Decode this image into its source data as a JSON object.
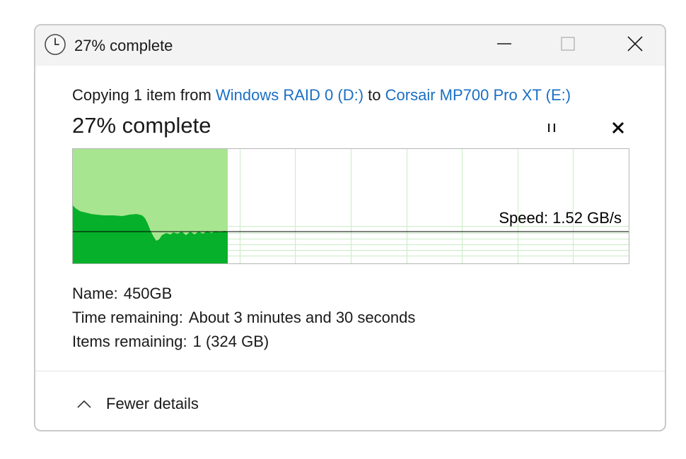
{
  "window": {
    "title": "27% complete"
  },
  "copy": {
    "prefix": "Copying 1 item from",
    "source": "Windows RAID 0 (D:)",
    "connector": "to",
    "destination": "Corsair MP700 Pro XT (E:)"
  },
  "progress": {
    "heading": "27% complete",
    "fraction": 0.27,
    "speed_label": "Speed: 1.52 GB/s"
  },
  "details": {
    "name_key": "Name:",
    "name_value": "450GB",
    "time_key": "Time remaining:",
    "time_value": "About 3 minutes and 30 seconds",
    "items_key": "Items remaining:",
    "items_value": "1 (324 GB)"
  },
  "footer": {
    "toggle_label": "Fewer details"
  },
  "colors": {
    "progress_fill": "#a8e591",
    "speed_fill": "#06b02a",
    "grid": "#c9ecc5",
    "link": "#1a6fc4"
  },
  "icons": {
    "title": "clock-icon",
    "minimize": "minimize-icon",
    "maximize": "maximize-icon",
    "close": "close-icon",
    "pause": "pause-icon",
    "cancel": "cancel-icon",
    "toggle": "chevron-up-icon"
  }
}
